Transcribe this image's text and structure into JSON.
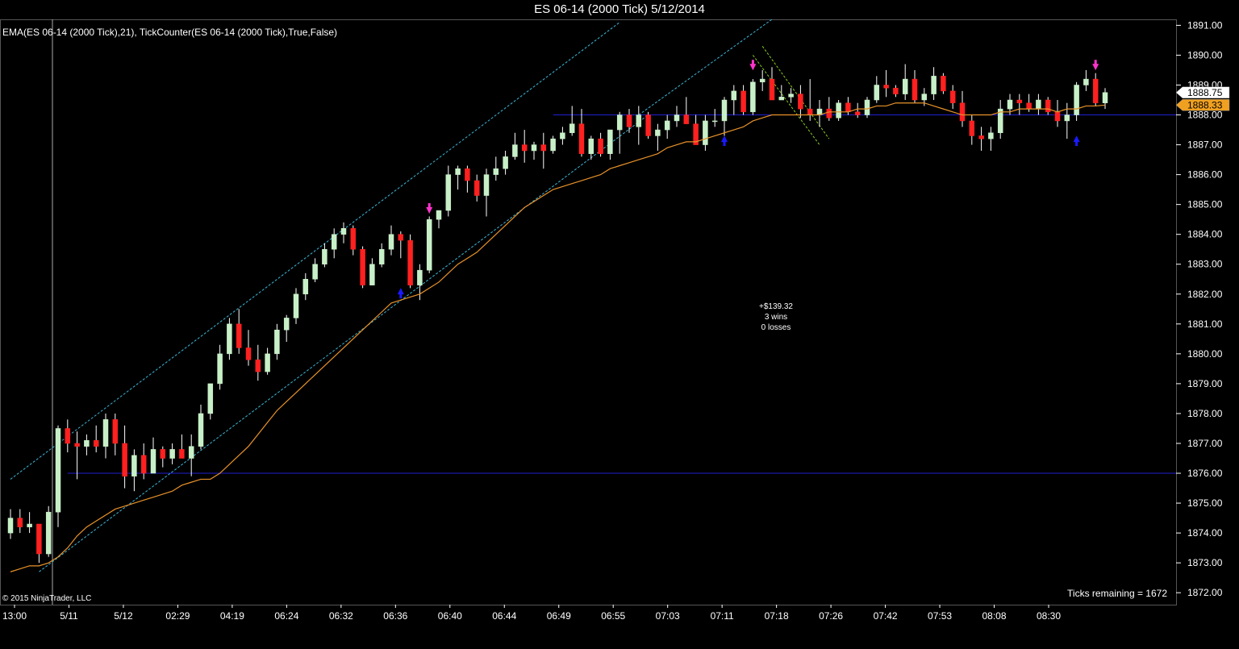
{
  "header": {
    "title": "ES 06-14 (2000 Tick)  5/12/2014",
    "indicator_label": "EMA(ES 06-14 (2000 Tick),21),  TickCounter(ES 06-14 (2000 Tick),True,False)"
  },
  "footer": {
    "copyright": "© 2015 NinjaTrader, LLC",
    "ticks_remaining": "Ticks remaining = 1672"
  },
  "stats": {
    "profit": "+$139.32",
    "wins": "3 wins",
    "losses": "0 losses"
  },
  "colors": {
    "background": "#000000",
    "up_candle": "#c8f0c8",
    "down_candle": "#ff2020",
    "wick": "#ffffff",
    "ema": "#e8922a",
    "channel": "#3fb6d6",
    "horizontal_line": "#1f1fd0",
    "green_trendline": "#88cc22",
    "entry_arrow": "#1a1aff",
    "exit_arrow": "#ff33cc",
    "last_price_tag": "#ffffff",
    "ema_tag": "#f0a020"
  },
  "chart_data": {
    "type": "candlestick",
    "y_range": [
      1871.6,
      1891.2
    ],
    "y_ticks": [
      "1891.00",
      "1890.00",
      "1889.00",
      "1888.00",
      "1887.00",
      "1886.00",
      "1885.00",
      "1884.00",
      "1883.00",
      "1882.00",
      "1881.00",
      "1880.00",
      "1879.00",
      "1878.00",
      "1877.00",
      "1876.00",
      "1875.00",
      "1874.00",
      "1873.00",
      "1872.00"
    ],
    "x_labels": [
      "13:00",
      "5/11",
      "5/12",
      "02:29",
      "04:19",
      "06:24",
      "06:32",
      "06:36",
      "06:40",
      "06:44",
      "06:49",
      "06:55",
      "07:03",
      "07:11",
      "07:18",
      "07:26",
      "07:42",
      "07:53",
      "08:08",
      "08:30"
    ],
    "last_price": "1888.75",
    "ema_value": "1888.33",
    "candles": [
      {
        "o": 1874.0,
        "h": 1874.8,
        "l": 1873.8,
        "c": 1874.5
      },
      {
        "o": 1874.5,
        "h": 1874.8,
        "l": 1874.0,
        "c": 1874.2
      },
      {
        "o": 1874.2,
        "h": 1874.7,
        "l": 1874.0,
        "c": 1874.3
      },
      {
        "o": 1874.3,
        "h": 1874.3,
        "l": 1873.0,
        "c": 1873.3
      },
      {
        "o": 1873.3,
        "h": 1874.9,
        "l": 1873.2,
        "c": 1874.7
      },
      {
        "o": 1874.7,
        "h": 1877.6,
        "l": 1874.2,
        "c": 1877.5
      },
      {
        "o": 1877.5,
        "h": 1877.8,
        "l": 1876.7,
        "c": 1877.0
      },
      {
        "o": 1877.0,
        "h": 1877.4,
        "l": 1875.8,
        "c": 1876.9
      },
      {
        "o": 1876.9,
        "h": 1877.3,
        "l": 1876.6,
        "c": 1877.1
      },
      {
        "o": 1877.1,
        "h": 1877.6,
        "l": 1876.7,
        "c": 1876.9
      },
      {
        "o": 1876.9,
        "h": 1878.0,
        "l": 1876.5,
        "c": 1877.8
      },
      {
        "o": 1877.8,
        "h": 1878.0,
        "l": 1876.6,
        "c": 1877.0
      },
      {
        "o": 1877.0,
        "h": 1877.6,
        "l": 1875.5,
        "c": 1875.9
      },
      {
        "o": 1875.9,
        "h": 1876.8,
        "l": 1875.4,
        "c": 1876.6
      },
      {
        "o": 1876.6,
        "h": 1877.0,
        "l": 1875.8,
        "c": 1876.0
      },
      {
        "o": 1876.0,
        "h": 1877.2,
        "l": 1876.0,
        "c": 1876.8
      },
      {
        "o": 1876.8,
        "h": 1876.9,
        "l": 1876.2,
        "c": 1876.5
      },
      {
        "o": 1876.5,
        "h": 1877.0,
        "l": 1876.3,
        "c": 1876.8
      },
      {
        "o": 1876.8,
        "h": 1877.3,
        "l": 1876.5,
        "c": 1876.5
      },
      {
        "o": 1876.5,
        "h": 1877.3,
        "l": 1875.9,
        "c": 1876.9
      },
      {
        "o": 1876.9,
        "h": 1878.3,
        "l": 1876.8,
        "c": 1878.0
      },
      {
        "o": 1878.0,
        "h": 1879.0,
        "l": 1877.8,
        "c": 1879.0
      },
      {
        "o": 1879.0,
        "h": 1880.3,
        "l": 1878.8,
        "c": 1880.0
      },
      {
        "o": 1880.0,
        "h": 1881.2,
        "l": 1879.8,
        "c": 1881.0
      },
      {
        "o": 1881.0,
        "h": 1881.5,
        "l": 1880.0,
        "c": 1880.2
      },
      {
        "o": 1880.2,
        "h": 1880.8,
        "l": 1879.6,
        "c": 1879.8
      },
      {
        "o": 1879.8,
        "h": 1880.3,
        "l": 1879.1,
        "c": 1879.4
      },
      {
        "o": 1879.4,
        "h": 1880.2,
        "l": 1879.3,
        "c": 1880.0
      },
      {
        "o": 1880.0,
        "h": 1881.0,
        "l": 1879.8,
        "c": 1880.8
      },
      {
        "o": 1880.8,
        "h": 1881.3,
        "l": 1880.4,
        "c": 1881.2
      },
      {
        "o": 1881.2,
        "h": 1882.2,
        "l": 1881.0,
        "c": 1882.0
      },
      {
        "o": 1882.0,
        "h": 1882.7,
        "l": 1881.8,
        "c": 1882.5
      },
      {
        "o": 1882.5,
        "h": 1883.2,
        "l": 1882.4,
        "c": 1883.0
      },
      {
        "o": 1883.0,
        "h": 1883.7,
        "l": 1882.9,
        "c": 1883.5
      },
      {
        "o": 1883.5,
        "h": 1884.2,
        "l": 1883.2,
        "c": 1884.0
      },
      {
        "o": 1884.0,
        "h": 1884.4,
        "l": 1883.7,
        "c": 1884.2
      },
      {
        "o": 1884.2,
        "h": 1884.3,
        "l": 1883.3,
        "c": 1883.5
      },
      {
        "o": 1883.5,
        "h": 1883.6,
        "l": 1882.2,
        "c": 1882.3
      },
      {
        "o": 1882.3,
        "h": 1883.2,
        "l": 1882.3,
        "c": 1883.0
      },
      {
        "o": 1883.0,
        "h": 1883.7,
        "l": 1882.9,
        "c": 1883.5
      },
      {
        "o": 1883.5,
        "h": 1884.3,
        "l": 1883.3,
        "c": 1884.0
      },
      {
        "o": 1884.0,
        "h": 1884.1,
        "l": 1883.2,
        "c": 1883.8
      },
      {
        "o": 1883.8,
        "h": 1884.0,
        "l": 1882.2,
        "c": 1882.3
      },
      {
        "o": 1882.3,
        "h": 1883.0,
        "l": 1881.8,
        "c": 1882.8
      },
      {
        "o": 1882.8,
        "h": 1884.6,
        "l": 1882.7,
        "c": 1884.5
      },
      {
        "o": 1884.5,
        "h": 1884.8,
        "l": 1884.2,
        "c": 1884.8
      },
      {
        "o": 1884.8,
        "h": 1886.3,
        "l": 1884.6,
        "c": 1886.0
      },
      {
        "o": 1886.0,
        "h": 1886.3,
        "l": 1885.5,
        "c": 1886.2
      },
      {
        "o": 1886.2,
        "h": 1886.3,
        "l": 1885.4,
        "c": 1885.8
      },
      {
        "o": 1885.8,
        "h": 1886.0,
        "l": 1885.1,
        "c": 1885.3
      },
      {
        "o": 1885.3,
        "h": 1886.2,
        "l": 1884.6,
        "c": 1886.0
      },
      {
        "o": 1886.0,
        "h": 1886.6,
        "l": 1885.8,
        "c": 1886.2
      },
      {
        "o": 1886.2,
        "h": 1886.8,
        "l": 1886.0,
        "c": 1886.6
      },
      {
        "o": 1886.6,
        "h": 1887.4,
        "l": 1886.5,
        "c": 1887.0
      },
      {
        "o": 1887.0,
        "h": 1887.5,
        "l": 1886.4,
        "c": 1886.8
      },
      {
        "o": 1886.8,
        "h": 1887.1,
        "l": 1886.5,
        "c": 1887.0
      },
      {
        "o": 1887.0,
        "h": 1887.4,
        "l": 1886.2,
        "c": 1886.8
      },
      {
        "o": 1886.8,
        "h": 1887.3,
        "l": 1886.7,
        "c": 1887.2
      },
      {
        "o": 1887.2,
        "h": 1887.6,
        "l": 1887.0,
        "c": 1887.4
      },
      {
        "o": 1887.4,
        "h": 1888.3,
        "l": 1887.3,
        "c": 1887.7
      },
      {
        "o": 1887.7,
        "h": 1888.2,
        "l": 1886.6,
        "c": 1886.7
      },
      {
        "o": 1886.7,
        "h": 1887.3,
        "l": 1886.5,
        "c": 1887.2
      },
      {
        "o": 1887.2,
        "h": 1887.4,
        "l": 1886.6,
        "c": 1886.7
      },
      {
        "o": 1886.7,
        "h": 1887.5,
        "l": 1886.5,
        "c": 1887.5
      },
      {
        "o": 1887.5,
        "h": 1888.1,
        "l": 1886.7,
        "c": 1888.0
      },
      {
        "o": 1888.0,
        "h": 1888.2,
        "l": 1887.4,
        "c": 1887.6
      },
      {
        "o": 1887.6,
        "h": 1888.3,
        "l": 1887.0,
        "c": 1888.0
      },
      {
        "o": 1888.0,
        "h": 1888.1,
        "l": 1887.2,
        "c": 1887.3
      },
      {
        "o": 1887.3,
        "h": 1887.7,
        "l": 1886.8,
        "c": 1887.5
      },
      {
        "o": 1887.5,
        "h": 1888.0,
        "l": 1887.2,
        "c": 1887.8
      },
      {
        "o": 1887.8,
        "h": 1888.3,
        "l": 1887.6,
        "c": 1888.0
      },
      {
        "o": 1888.0,
        "h": 1888.6,
        "l": 1887.8,
        "c": 1887.7
      },
      {
        "o": 1887.7,
        "h": 1888.0,
        "l": 1887.0,
        "c": 1887.0
      },
      {
        "o": 1887.0,
        "h": 1888.0,
        "l": 1886.8,
        "c": 1887.8
      },
      {
        "o": 1887.8,
        "h": 1888.2,
        "l": 1887.6,
        "c": 1887.8
      },
      {
        "o": 1887.8,
        "h": 1888.6,
        "l": 1887.3,
        "c": 1888.5
      },
      {
        "o": 1888.5,
        "h": 1889.0,
        "l": 1888.0,
        "c": 1888.8
      },
      {
        "o": 1888.8,
        "h": 1889.0,
        "l": 1888.0,
        "c": 1888.1
      },
      {
        "o": 1888.1,
        "h": 1889.2,
        "l": 1888.0,
        "c": 1889.1
      },
      {
        "o": 1889.1,
        "h": 1889.5,
        "l": 1888.8,
        "c": 1889.2
      },
      {
        "o": 1889.2,
        "h": 1889.6,
        "l": 1888.6,
        "c": 1888.5
      },
      {
        "o": 1888.5,
        "h": 1889.0,
        "l": 1888.5,
        "c": 1888.6
      },
      {
        "o": 1888.6,
        "h": 1888.9,
        "l": 1888.4,
        "c": 1888.7
      },
      {
        "o": 1888.7,
        "h": 1889.0,
        "l": 1887.9,
        "c": 1888.2
      },
      {
        "o": 1888.2,
        "h": 1889.2,
        "l": 1887.8,
        "c": 1888.0
      },
      {
        "o": 1888.0,
        "h": 1888.5,
        "l": 1887.6,
        "c": 1888.2
      },
      {
        "o": 1888.2,
        "h": 1888.6,
        "l": 1887.8,
        "c": 1887.9
      },
      {
        "o": 1887.9,
        "h": 1888.5,
        "l": 1887.8,
        "c": 1888.4
      },
      {
        "o": 1888.4,
        "h": 1888.6,
        "l": 1888.0,
        "c": 1888.1
      },
      {
        "o": 1888.1,
        "h": 1888.4,
        "l": 1887.9,
        "c": 1888.0
      },
      {
        "o": 1888.0,
        "h": 1888.6,
        "l": 1887.9,
        "c": 1888.5
      },
      {
        "o": 1888.5,
        "h": 1889.3,
        "l": 1888.4,
        "c": 1889.0
      },
      {
        "o": 1889.0,
        "h": 1889.5,
        "l": 1888.6,
        "c": 1888.9
      },
      {
        "o": 1888.9,
        "h": 1889.0,
        "l": 1888.6,
        "c": 1888.7
      },
      {
        "o": 1888.7,
        "h": 1889.7,
        "l": 1888.5,
        "c": 1889.2
      },
      {
        "o": 1889.2,
        "h": 1889.5,
        "l": 1888.4,
        "c": 1888.5
      },
      {
        "o": 1888.5,
        "h": 1888.9,
        "l": 1888.3,
        "c": 1888.7
      },
      {
        "o": 1888.7,
        "h": 1889.6,
        "l": 1888.5,
        "c": 1889.3
      },
      {
        "o": 1889.3,
        "h": 1889.4,
        "l": 1888.7,
        "c": 1888.8
      },
      {
        "o": 1888.8,
        "h": 1889.0,
        "l": 1888.2,
        "c": 1888.4
      },
      {
        "o": 1888.4,
        "h": 1888.8,
        "l": 1887.6,
        "c": 1887.8
      },
      {
        "o": 1887.8,
        "h": 1888.0,
        "l": 1887.0,
        "c": 1887.3
      },
      {
        "o": 1887.3,
        "h": 1887.6,
        "l": 1886.8,
        "c": 1887.2
      },
      {
        "o": 1887.2,
        "h": 1887.6,
        "l": 1886.8,
        "c": 1887.4
      },
      {
        "o": 1887.4,
        "h": 1888.5,
        "l": 1887.2,
        "c": 1888.2
      },
      {
        "o": 1888.2,
        "h": 1888.7,
        "l": 1888.0,
        "c": 1888.5
      },
      {
        "o": 1888.5,
        "h": 1888.7,
        "l": 1888.0,
        "c": 1888.4
      },
      {
        "o": 1888.4,
        "h": 1888.7,
        "l": 1888.1,
        "c": 1888.2
      },
      {
        "o": 1888.2,
        "h": 1888.7,
        "l": 1888.0,
        "c": 1888.5
      },
      {
        "o": 1888.5,
        "h": 1888.6,
        "l": 1888.0,
        "c": 1888.1
      },
      {
        "o": 1888.1,
        "h": 1888.5,
        "l": 1887.6,
        "c": 1887.8
      },
      {
        "o": 1887.8,
        "h": 1888.4,
        "l": 1887.2,
        "c": 1888.0
      },
      {
        "o": 1888.0,
        "h": 1889.1,
        "l": 1887.8,
        "c": 1889.0
      },
      {
        "o": 1889.0,
        "h": 1889.5,
        "l": 1888.8,
        "c": 1889.2
      },
      {
        "o": 1889.2,
        "h": 1889.4,
        "l": 1888.3,
        "c": 1888.4
      },
      {
        "o": 1888.4,
        "h": 1888.9,
        "l": 1888.2,
        "c": 1888.75
      }
    ],
    "ema": [
      1872.7,
      1872.8,
      1872.9,
      1872.9,
      1873.0,
      1873.2,
      1873.5,
      1873.9,
      1874.2,
      1874.4,
      1874.6,
      1874.8,
      1874.9,
      1875.0,
      1875.1,
      1875.2,
      1875.3,
      1875.4,
      1875.6,
      1875.7,
      1875.8,
      1875.8,
      1876.0,
      1876.3,
      1876.6,
      1876.9,
      1877.3,
      1877.7,
      1878.1,
      1878.4,
      1878.7,
      1879.0,
      1879.3,
      1879.6,
      1879.9,
      1880.2,
      1880.5,
      1880.8,
      1881.1,
      1881.4,
      1881.7,
      1881.8,
      1881.9,
      1882.0,
      1882.2,
      1882.4,
      1882.7,
      1883.0,
      1883.2,
      1883.4,
      1883.7,
      1884.0,
      1884.3,
      1884.6,
      1884.9,
      1885.1,
      1885.3,
      1885.5,
      1885.6,
      1885.7,
      1885.8,
      1885.9,
      1886.0,
      1886.2,
      1886.3,
      1886.4,
      1886.5,
      1886.6,
      1886.7,
      1886.9,
      1887.0,
      1887.1,
      1887.1,
      1887.2,
      1887.3,
      1887.4,
      1887.5,
      1887.6,
      1887.8,
      1887.9,
      1888.0,
      1888.0,
      1888.0,
      1888.0,
      1888.0,
      1888.0,
      1888.1,
      1888.1,
      1888.1,
      1888.2,
      1888.2,
      1888.3,
      1888.3,
      1888.4,
      1888.4,
      1888.4,
      1888.4,
      1888.3,
      1888.2,
      1888.1,
      1888.0,
      1888.0,
      1888.0,
      1888.0,
      1888.1,
      1888.1,
      1888.2,
      1888.2,
      1888.2,
      1888.2,
      1888.1,
      1888.2,
      1888.2,
      1888.3,
      1888.3,
      1888.33
    ],
    "horizontal_lines": [
      {
        "from_index": 6,
        "price": 1876.0
      },
      {
        "from_index": 57,
        "price": 1888.0
      }
    ],
    "channel_lines": [
      {
        "from_index": 0,
        "from_price": 1875.8,
        "to_index": 64,
        "to_price": 1891.1
      },
      {
        "from_index": 3,
        "from_price": 1872.7,
        "to_index": 67,
        "to_price": 1888.0
      },
      {
        "from_index": 66,
        "from_price": 1888.0,
        "to_index": 80,
        "to_price": 1891.2
      }
    ],
    "green_trendlines": [
      {
        "from_index": 78,
        "from_price": 1890.0,
        "to_index": 85,
        "to_price": 1887.0
      },
      {
        "from_index": 79,
        "from_price": 1890.3,
        "to_index": 86,
        "to_price": 1887.2
      }
    ],
    "entry_arrows": [
      {
        "index": 41,
        "price": 1882.1,
        "dir": "up"
      },
      {
        "index": 75,
        "price": 1887.2,
        "dir": "up"
      },
      {
        "index": 112,
        "price": 1887.2,
        "dir": "up"
      }
    ],
    "exit_arrows": [
      {
        "index": 44,
        "price": 1884.8,
        "dir": "down"
      },
      {
        "index": 78,
        "price": 1889.6,
        "dir": "down"
      },
      {
        "index": 114,
        "price": 1889.6,
        "dir": "down"
      }
    ]
  }
}
